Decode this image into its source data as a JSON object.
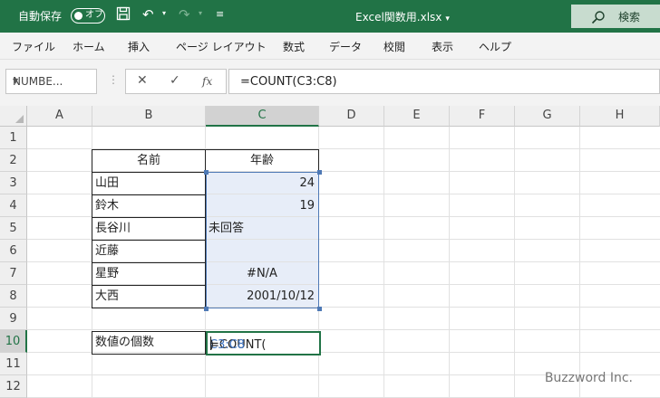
{
  "titlebar": {
    "autosave_label": "自動保存",
    "autosave_state": "オフ",
    "doc_title": "Excel関数用.xlsx",
    "search_label": "検索",
    "colors": {
      "bar": "#217346",
      "search": "#c8dccf"
    }
  },
  "ribbon": {
    "tabs": [
      "ファイル",
      "ホーム",
      "挿入",
      "ページ レイアウト",
      "数式",
      "データ",
      "校閲",
      "表示",
      "ヘルプ"
    ]
  },
  "formula_bar": {
    "name_box": "NUMBE...",
    "cancel_icon": "✕",
    "enter_icon": "✓",
    "fx_icon": "fx",
    "formula": "=COUNT(C3:C8)"
  },
  "grid": {
    "columns": [
      "A",
      "B",
      "C",
      "D",
      "E",
      "F",
      "G",
      "H"
    ],
    "rows": [
      "1",
      "2",
      "3",
      "4",
      "5",
      "6",
      "7",
      "8",
      "9",
      "10",
      "11",
      "12"
    ],
    "selected_column": "C",
    "selected_row": "10"
  },
  "table": {
    "header": {
      "name": "名前",
      "age": "年齢"
    },
    "rows": [
      {
        "name": "山田",
        "age": "24"
      },
      {
        "name": "鈴木",
        "age": "19"
      },
      {
        "name": "長谷川",
        "age": "未回答"
      },
      {
        "name": "近藤",
        "age": ""
      },
      {
        "name": "星野",
        "age": "#N/A"
      },
      {
        "name": "大西",
        "age": "2001/10/12"
      }
    ],
    "summary_label": "数値の個数",
    "edit_prefix": "=COUNT(",
    "edit_ref": "C3:C8",
    "edit_suffix": ")"
  },
  "watermark": "Buzzword Inc."
}
